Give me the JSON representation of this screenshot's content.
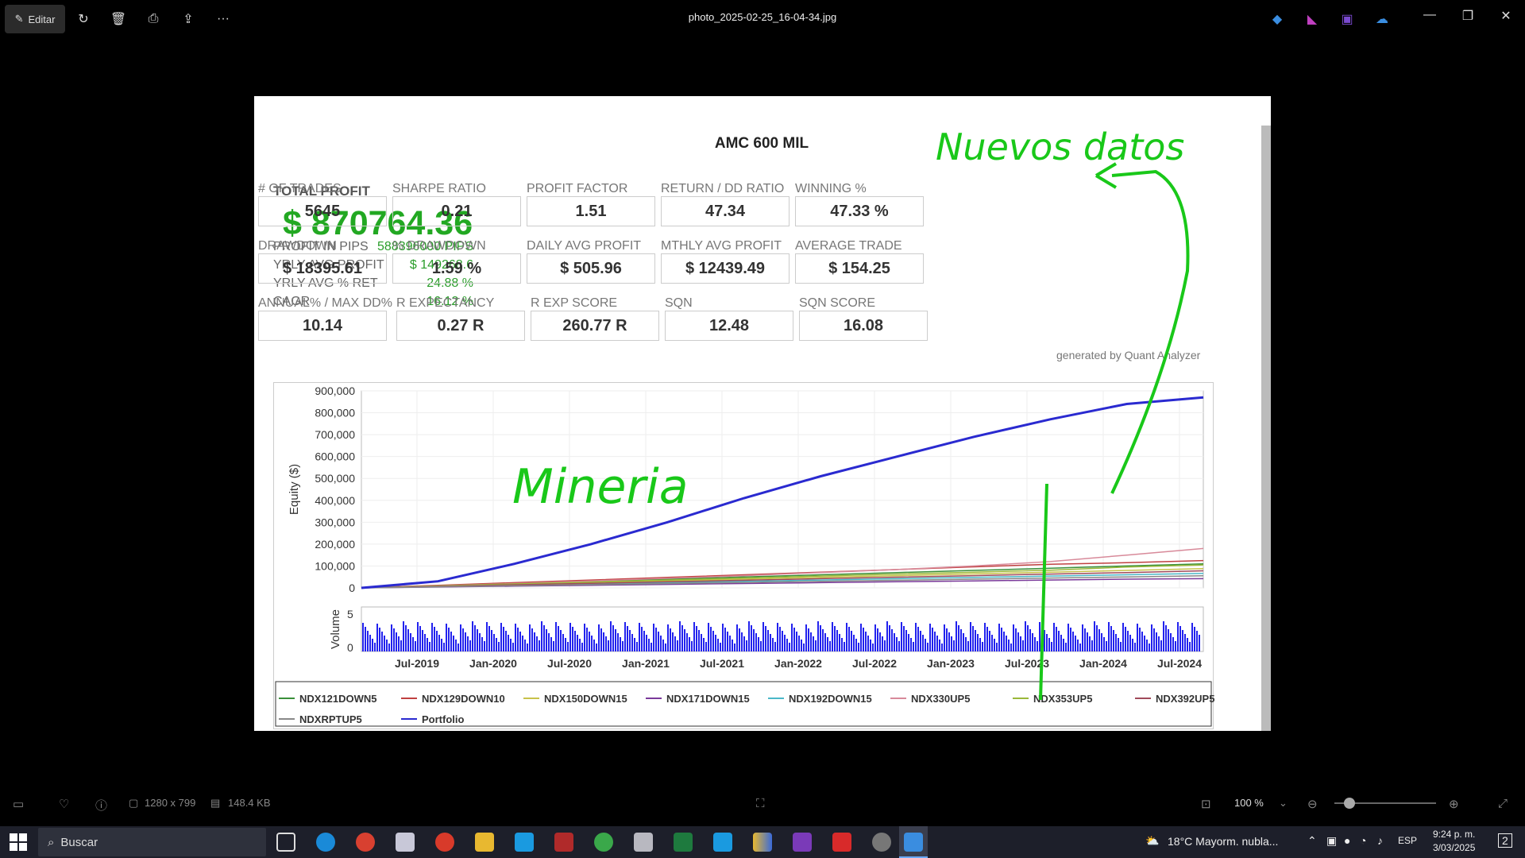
{
  "window": {
    "edit_label": "Editar",
    "title": "photo_2025-02-25_16-04-34.jpg"
  },
  "report": {
    "title": "AMC 600 MIL",
    "total_profit_label": "TOTAL PROFIT",
    "total_profit": "$ 870764.36",
    "kv": [
      {
        "k": "PROFIT IN PIPS",
        "v": "588396000 PIPS"
      },
      {
        "k": "YRLY AVG PROFIT",
        "v": "$ 149268.6"
      },
      {
        "k": "YRLY AVG % RET",
        "v": "24.88 %"
      },
      {
        "k": "CAGR",
        "v": "16.12 %"
      }
    ],
    "stats": [
      {
        "label": "# OF TRADES",
        "value": "5645"
      },
      {
        "label": "SHARPE RATIO",
        "value": "0.21"
      },
      {
        "label": "PROFIT FACTOR",
        "value": "1.51"
      },
      {
        "label": "RETURN / DD RATIO",
        "value": "47.34"
      },
      {
        "label": "WINNING %",
        "value": "47.33 %"
      },
      {
        "label": "DRAWDOWN",
        "value": "$ 18395.61"
      },
      {
        "label": "% DRAWDOWN",
        "value": "1.59 %"
      },
      {
        "label": "DAILY AVG PROFIT",
        "value": "$ 505.96"
      },
      {
        "label": "MTHLY AVG PROFIT",
        "value": "$ 12439.49"
      },
      {
        "label": "AVERAGE TRADE",
        "value": "$ 154.25"
      },
      {
        "label": "ANNUAL% / MAX DD%",
        "value": "10.14"
      },
      {
        "label": "R EXPECTANCY",
        "value": "0.27 R"
      },
      {
        "label": "R EXP SCORE",
        "value": "260.77 R"
      },
      {
        "label": "SQN",
        "value": "12.48"
      },
      {
        "label": "SQN SCORE",
        "value": "16.08"
      }
    ],
    "generated": "generated by Quant Analyzer",
    "handwriting": {
      "top": "Nuevos datos",
      "middle": "Mineria"
    }
  },
  "chart_data": {
    "type": "line",
    "ylabel": "Equity ($)",
    "y_ticks": [
      "900,000",
      "800,000",
      "700,000",
      "600,000",
      "500,000",
      "400,000",
      "300,000",
      "200,000",
      "100,000",
      "0"
    ],
    "ylim": [
      0,
      900000
    ],
    "x_ticks": [
      "Jul-2019",
      "Jan-2020",
      "Jul-2020",
      "Jan-2021",
      "Jul-2021",
      "Jan-2022",
      "Jul-2022",
      "Jan-2023",
      "Jul-2023",
      "Jan-2024",
      "Jul-2024"
    ],
    "volume_label": "Volume",
    "volume_ticks": [
      "5",
      "0"
    ],
    "series": [
      {
        "name": "NDX121DOWN5",
        "color": "#3a8f3a",
        "values": [
          0,
          10000,
          20000,
          30000,
          40000,
          50000,
          60000,
          70000,
          80000,
          90000,
          100000,
          110000
        ]
      },
      {
        "name": "NDX129DOWN10",
        "color": "#c04040",
        "values": [
          0,
          12000,
          24000,
          36000,
          48000,
          60000,
          72000,
          84000,
          96000,
          108000,
          115000,
          125000
        ]
      },
      {
        "name": "NDX150DOWN15",
        "color": "#c8c24a",
        "values": [
          0,
          8000,
          16000,
          24000,
          32000,
          40000,
          48000,
          56000,
          64000,
          72000,
          80000,
          88000
        ]
      },
      {
        "name": "NDX171DOWN15",
        "color": "#7a3a9a",
        "values": [
          0,
          4000,
          8000,
          12000,
          16000,
          20000,
          24000,
          28000,
          32000,
          36000,
          40000,
          42000
        ]
      },
      {
        "name": "NDX192DOWN15",
        "color": "#4ab8c8",
        "values": [
          0,
          6000,
          12000,
          18000,
          24000,
          30000,
          36000,
          42000,
          48000,
          54000,
          60000,
          66000
        ]
      },
      {
        "name": "NDX330UP5",
        "color": "#d88a9a",
        "values": [
          0,
          10000,
          20000,
          32000,
          44000,
          56000,
          70000,
          84000,
          100000,
          120000,
          150000,
          180000
        ]
      },
      {
        "name": "NDX353UP5",
        "color": "#9ab83a",
        "values": [
          0,
          9000,
          18000,
          27000,
          36000,
          45000,
          54000,
          63000,
          72000,
          81000,
          95000,
          105000
        ]
      },
      {
        "name": "NDX392UP5",
        "color": "#a04a5a",
        "values": [
          0,
          7000,
          14000,
          21000,
          28000,
          35000,
          42000,
          49000,
          56000,
          63000,
          70000,
          78000
        ]
      },
      {
        "name": "NDXRPTUP5",
        "color": "#888888",
        "values": [
          0,
          5000,
          10000,
          15000,
          20000,
          25000,
          30000,
          35000,
          40000,
          45000,
          50000,
          55000
        ]
      },
      {
        "name": "Portfolio",
        "color": "#2a2ad0",
        "values": [
          0,
          30000,
          110000,
          200000,
          300000,
          410000,
          510000,
          600000,
          690000,
          770000,
          840000,
          870000
        ]
      }
    ]
  },
  "statusbar": {
    "dimensions": "1280 x 799",
    "size": "148.4 KB",
    "zoom": "100 %"
  },
  "taskbar": {
    "search": "Buscar",
    "weather": "18°C  Mayorm. nubla...",
    "lang": "ESP",
    "time": "9:24 p. m.",
    "date": "3/03/2025",
    "notif": "2"
  }
}
